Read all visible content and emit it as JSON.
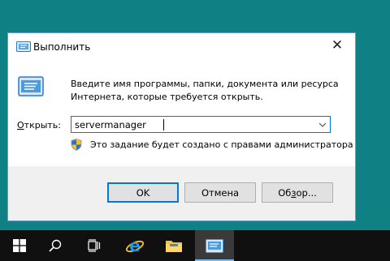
{
  "dialog": {
    "title": "Выполнить",
    "close_glyph": "✕",
    "description_line1": "Введите имя программы, папки, документа или ресурса",
    "description_line2": "Интернета, которые требуется открыть.",
    "open_label_prefix": "О",
    "open_label_rest": "ткрыть:",
    "open_value": "servermanager",
    "admin_note": "Это задание будет создано с правами администратора",
    "ok_label": "OK",
    "cancel_label": "Отмена",
    "browse_label_prefix": "Об",
    "browse_label_underlined": "з",
    "browse_label_rest": "ор..."
  },
  "taskbar": {
    "items": [
      {
        "name": "start-button",
        "icon": "windows-icon"
      },
      {
        "name": "search-button",
        "icon": "search-icon"
      },
      {
        "name": "task-view-button",
        "icon": "task-view-icon"
      },
      {
        "name": "internet-explorer-button",
        "icon": "internet-explorer-icon"
      },
      {
        "name": "file-explorer-button",
        "icon": "folder-icon"
      },
      {
        "name": "run-app-button",
        "icon": "run-icon",
        "active": true
      }
    ]
  },
  "colors": {
    "desktop": "#0f8083",
    "accent": "#0078d7",
    "taskbar": "#101010"
  }
}
